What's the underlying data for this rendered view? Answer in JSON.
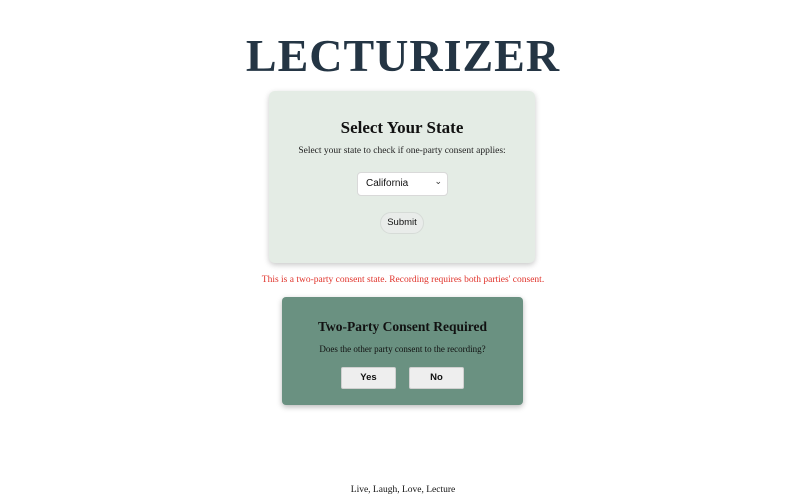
{
  "header": {
    "title": "LECTURIZER"
  },
  "state_selector": {
    "heading": "Select Your State",
    "description": "Select your state to check if one-party consent applies:",
    "selected_state": "California",
    "chevron_icon": "chevron-down-icon",
    "submit_label": "Submit"
  },
  "result": {
    "warning": "This is a two-party consent state. Recording requires both parties' consent.",
    "warning_color": "#e0332b"
  },
  "consent": {
    "heading": "Two-Party Consent Required",
    "question": "Does the other party consent to the recording?",
    "yes_label": "Yes",
    "no_label": "No",
    "card_color": "#6a9181"
  },
  "footer": {
    "tagline": "Live, Laugh, Love, Lecture"
  },
  "colors": {
    "title": "#243544",
    "state_card_bg": "#e4ece5"
  }
}
